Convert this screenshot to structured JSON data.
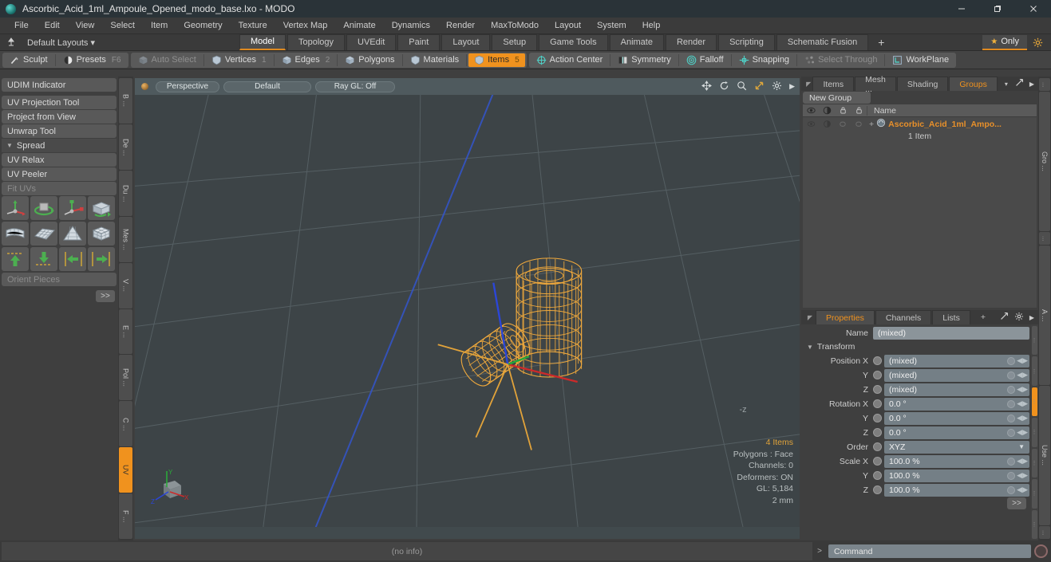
{
  "window": {
    "title": "Ascorbic_Acid_1ml_Ampoule_Opened_modo_base.lxo - MODO",
    "minimize": "minimize-icon",
    "maximize": "maximize-icon",
    "close": "close-icon"
  },
  "menubar": {
    "items": [
      "File",
      "Edit",
      "View",
      "Select",
      "Item",
      "Geometry",
      "Texture",
      "Vertex Map",
      "Animate",
      "Dynamics",
      "Render",
      "MaxToModo",
      "Layout",
      "System",
      "Help"
    ]
  },
  "layoutbar": {
    "default_layouts": "Default Layouts",
    "tabs": [
      {
        "label": "Model",
        "active": true
      },
      {
        "label": "Topology",
        "active": false
      },
      {
        "label": "UVEdit",
        "active": false
      },
      {
        "label": "Paint",
        "active": false
      },
      {
        "label": "Layout",
        "active": false
      },
      {
        "label": "Setup",
        "active": false
      },
      {
        "label": "Game Tools",
        "active": false
      },
      {
        "label": "Animate",
        "active": false
      },
      {
        "label": "Render",
        "active": false
      },
      {
        "label": "Scripting",
        "active": false
      },
      {
        "label": "Schematic Fusion",
        "active": false
      }
    ],
    "add_tab": "+",
    "only_label": "Only"
  },
  "toolbar": {
    "left_group": [
      {
        "label": "Sculpt",
        "icon": "brush-icon",
        "dim": false,
        "active": false,
        "num": ""
      },
      {
        "label": "Presets",
        "icon": "sphere-icon",
        "dim": false,
        "active": false,
        "num": "F6"
      }
    ],
    "selection_group": [
      {
        "label": "Auto Select",
        "icon": "cube-icon",
        "dim": true,
        "active": false,
        "num": ""
      },
      {
        "label": "Vertices",
        "icon": "shield-icon",
        "dim": false,
        "active": false,
        "num": "1"
      },
      {
        "label": "Edges",
        "icon": "cube-icon",
        "dim": false,
        "active": false,
        "num": "2"
      },
      {
        "label": "Polygons",
        "icon": "cube-icon",
        "dim": false,
        "active": false,
        "num": ""
      },
      {
        "label": "Materials",
        "icon": "shield-icon",
        "dim": false,
        "active": false,
        "num": ""
      },
      {
        "label": "Items",
        "icon": "shield-icon",
        "dim": false,
        "active": true,
        "num": "5"
      }
    ],
    "right_group": [
      {
        "label": "Action Center",
        "icon": "target-icon",
        "dim": false,
        "active": false,
        "num": ""
      },
      {
        "label": "Symmetry",
        "icon": "symmetry-icon",
        "dim": false,
        "active": false,
        "num": ""
      },
      {
        "label": "Falloff",
        "icon": "falloff-icon",
        "dim": false,
        "active": false,
        "num": ""
      },
      {
        "label": "Snapping",
        "icon": "snapping-icon",
        "dim": false,
        "active": false,
        "num": ""
      },
      {
        "label": "Select Through",
        "icon": "select-through-icon",
        "dim": true,
        "active": false,
        "num": ""
      },
      {
        "label": "WorkPlane",
        "icon": "workplane-icon",
        "dim": false,
        "active": false,
        "num": ""
      }
    ]
  },
  "left_panel": {
    "tools_top": [
      {
        "label": "UDIM Indicator",
        "dim": false
      }
    ],
    "tools_mid": [
      {
        "label": "UV Projection Tool",
        "dim": false
      },
      {
        "label": "Project from View",
        "dim": false
      },
      {
        "label": "Unwrap Tool",
        "dim": false
      }
    ],
    "section": "Spread",
    "tools_bot": [
      {
        "label": "UV Relax",
        "dim": false
      },
      {
        "label": "UV Peeler",
        "dim": false
      },
      {
        "label": "Fit UVs",
        "dim": true
      }
    ],
    "orient_pieces": "Orient Pieces",
    "expand": ">>",
    "icon_rows": [
      [
        "move-axis-icon",
        "rotate-ring-icon",
        "scale-axis-icon",
        "flip-box-icon"
      ],
      [
        "bend-grid-icon",
        "flat-grid-icon",
        "cone-grid-icon",
        "cube-grid-icon"
      ],
      [
        "align-up-icon",
        "align-down-icon",
        "align-left-icon",
        "align-right-icon"
      ]
    ],
    "vtabs": [
      "B ...",
      "De ...",
      "Du ...",
      "Mes ...",
      "V ...",
      "E ...",
      "Pol ...",
      "C ...",
      "UV",
      "F ..."
    ],
    "vtab_active": "UV"
  },
  "viewport": {
    "buttons": [
      "Perspective",
      "Default",
      "Ray GL: Off"
    ],
    "tools": [
      "pan-icon",
      "rotate-icon",
      "zoom-icon",
      "fit-icon",
      "gear-icon",
      "chevron-right-icon"
    ],
    "info": {
      "items": "4 Items",
      "polygons": "Polygons : Face",
      "channels": "Channels: 0",
      "deformers": "Deformers: ON",
      "gl": "GL: 5,184",
      "scale": "2 mm"
    },
    "axis_labels": {
      "x": "X",
      "y": "Y",
      "z": "Z"
    },
    "z_marker": "-z"
  },
  "right_panel": {
    "tabs": [
      {
        "label": "Items",
        "active": false
      },
      {
        "label": "Mesh ...",
        "active": false
      },
      {
        "label": "Shading",
        "active": false
      },
      {
        "label": "Groups",
        "active": true
      }
    ],
    "new_group": "New Group",
    "list_header": {
      "columns": [
        "visibility-icon",
        "render-icon",
        "lock-icon",
        "select-icon"
      ],
      "name": "Name"
    },
    "rows": [
      {
        "name": "Ascorbic_Acid_1ml_Ampo...",
        "count": "1 Item",
        "icon": "group-icon",
        "expand": "+"
      }
    ]
  },
  "properties": {
    "tabs": [
      {
        "label": "Properties",
        "active": true
      },
      {
        "label": "Channels",
        "active": false
      },
      {
        "label": "Lists",
        "active": false
      },
      {
        "label": "+",
        "active": false
      }
    ],
    "name_label": "Name",
    "name_value": "(mixed)",
    "transform_section": "Transform",
    "fields": [
      {
        "label": "Position X",
        "value": "(mixed)",
        "type": "num"
      },
      {
        "label": "Y",
        "value": "(mixed)",
        "type": "num"
      },
      {
        "label": "Z",
        "value": "(mixed)",
        "type": "num"
      },
      {
        "label": "Rotation X",
        "value": "0.0 °",
        "type": "num"
      },
      {
        "label": "Y",
        "value": "0.0 °",
        "type": "num"
      },
      {
        "label": "Z",
        "value": "0.0 °",
        "type": "num"
      },
      {
        "label": "Order",
        "value": "XYZ",
        "type": "select"
      },
      {
        "label": "Scale X",
        "value": "100.0 %",
        "type": "num"
      },
      {
        "label": "Y",
        "value": "100.0 %",
        "type": "num"
      },
      {
        "label": "Z",
        "value": "100.0 %",
        "type": "num"
      }
    ],
    "expand": ">>",
    "vtabs": [
      "...",
      "Gro ...",
      "...",
      "A ...",
      "Use ...",
      "..."
    ]
  },
  "statusbar": {
    "info": "(no info)",
    "command_caret": ">",
    "command_placeholder": "Command"
  },
  "colors": {
    "accent": "#f0921e",
    "wireframe": "#f0a93c",
    "axis_x": "#cc2222",
    "axis_y": "#22aa33",
    "axis_z": "#2244dd",
    "viewport_bg": "#3d4447"
  }
}
